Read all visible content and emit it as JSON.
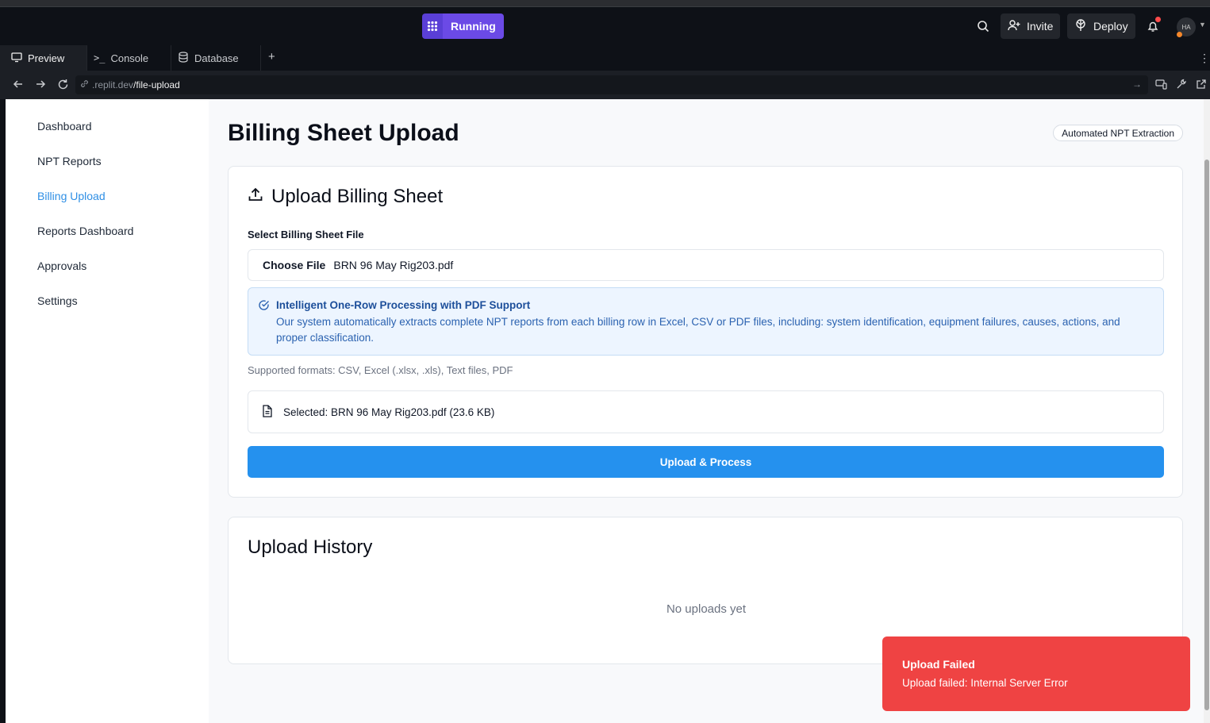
{
  "workspace": {
    "status_label": "Running",
    "invite_label": "Invite",
    "deploy_label": "Deploy",
    "avatar_initials": "HA"
  },
  "tabs": [
    {
      "label": "Preview",
      "icon": "monitor-icon"
    },
    {
      "label": "Console",
      "icon": "terminal-icon"
    },
    {
      "label": "Database",
      "icon": "database-icon"
    }
  ],
  "address_bar": {
    "host": ".replit.dev",
    "path": "/file-upload"
  },
  "sidebar": {
    "items": [
      {
        "label": "Dashboard"
      },
      {
        "label": "NPT Reports"
      },
      {
        "label": "Billing Upload",
        "active": true
      },
      {
        "label": "Reports Dashboard"
      },
      {
        "label": "Approvals"
      },
      {
        "label": "Settings"
      }
    ]
  },
  "page": {
    "title": "Billing Sheet Upload",
    "badge": "Automated NPT Extraction"
  },
  "upload_card": {
    "title": "Upload Billing Sheet",
    "field_label": "Select Billing Sheet File",
    "choose_label": "Choose File",
    "file_name": "BRN 96 May Rig203.pdf",
    "info_title": "Intelligent One-Row Processing with PDF Support",
    "info_body": "Our system automatically extracts complete NPT reports from each billing row in Excel, CSV or PDF files, including: system identification, equipment failures, causes, actions, and proper classification.",
    "formats": "Supported formats: CSV, Excel (.xlsx, .xls), Text files, PDF",
    "selected_text": "Selected: BRN 96 May Rig203.pdf (23.6 KB)",
    "button_label": "Upload & Process"
  },
  "history_card": {
    "title": "Upload History",
    "empty_text": "No uploads yet"
  },
  "toast": {
    "title": "Upload Failed",
    "message": "Upload failed: Internal Server Error"
  },
  "colors": {
    "accent": "#2591ee",
    "active_nav": "#2f8fe5",
    "error": "#ef4343",
    "running": "#6b4ae6"
  }
}
